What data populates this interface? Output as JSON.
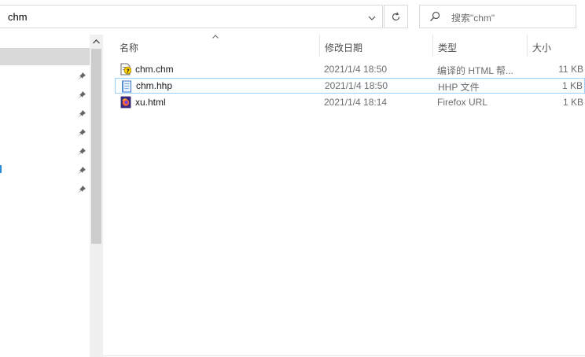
{
  "address_bar": {
    "path": "chm"
  },
  "search": {
    "placeholder": "搜索\"chm\""
  },
  "columns": {
    "name": "名称",
    "date": "修改日期",
    "type": "类型",
    "size": "大小"
  },
  "files": [
    {
      "name": "chm.chm",
      "date": "2021/1/4 18:50",
      "type": "编译的 HTML 帮...",
      "size": "11 KB",
      "icon": "chm-help-file-icon"
    },
    {
      "name": "chm.hhp",
      "date": "2021/1/4 18:50",
      "type": "HHP 文件",
      "size": "1 KB",
      "icon": "hhp-file-icon"
    },
    {
      "name": "xu.html",
      "date": "2021/1/4 18:14",
      "type": "Firefox URL",
      "size": "1 KB",
      "icon": "firefox-html-file-icon"
    }
  ],
  "colors": {
    "selection_border": "#99d1ff",
    "nav_selected": "#d9d9d9",
    "accent": "#2b8ad8"
  }
}
